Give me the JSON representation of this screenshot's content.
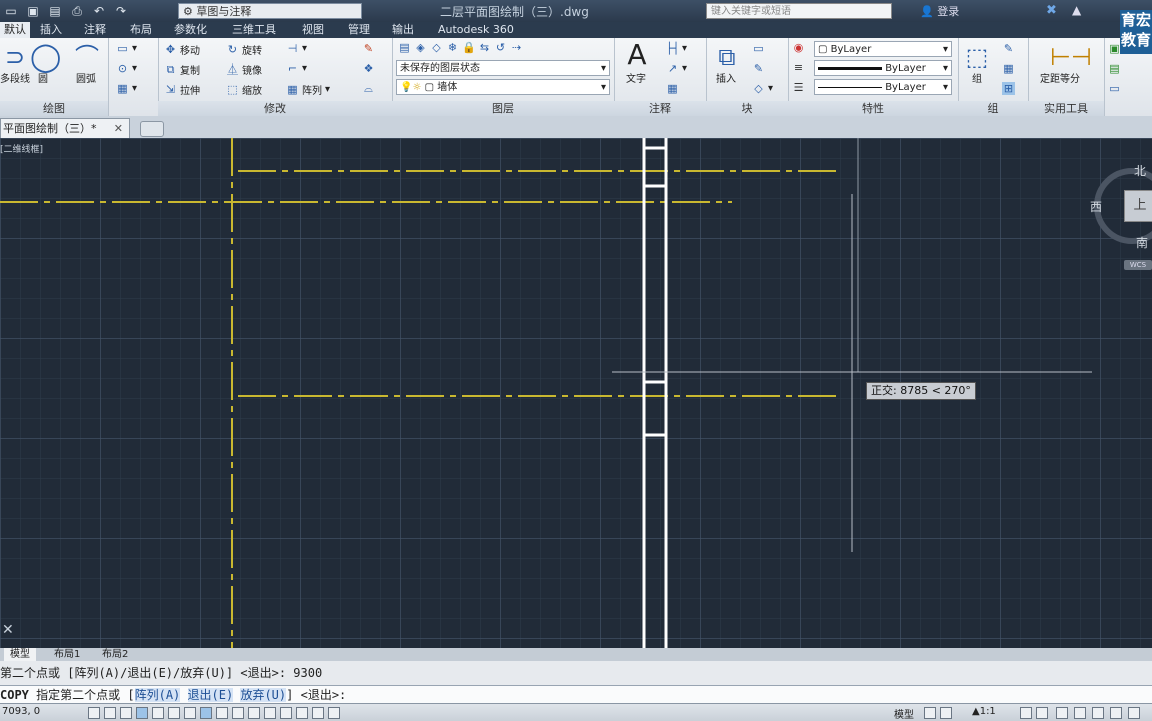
{
  "window": {
    "title": "二层平面图绘制（三）.dwg",
    "workspace": "草图与注释",
    "search_placeholder": "键入关键字或短语",
    "login": "登录"
  },
  "ribbon_tabs": [
    "默认",
    "插入",
    "注释",
    "布局",
    "参数化",
    "三维工具",
    "视图",
    "管理",
    "输出",
    "Autodesk 360"
  ],
  "panels": {
    "draw": {
      "label": "绘图",
      "tools": [
        "多段线",
        "圆",
        "圆弧"
      ]
    },
    "modify": {
      "label": "修改",
      "tools": [
        "移动",
        "旋转",
        "复制",
        "镜像",
        "拉伸",
        "缩放",
        "阵列"
      ]
    },
    "layers": {
      "label": "图层",
      "state": "未保存的图层状态",
      "current_layer": "墙体"
    },
    "annotation": {
      "label": "注释",
      "text_tool": "文字"
    },
    "block": {
      "label": "块",
      "insert_tool": "插入"
    },
    "properties": {
      "label": "特性",
      "color": "ByLayer",
      "linetype": "ByLayer",
      "lineweight": "ByLayer"
    },
    "groups": {
      "label": "组",
      "group_tool": "组"
    },
    "utilities": {
      "label": "实用工具",
      "measure_tool": "定距等分"
    }
  },
  "document_tab": "平面图绘制（三）*",
  "viewport_label": "[二维线框]",
  "viewcube": {
    "north": "北",
    "west": "西",
    "south": "南",
    "top": "上",
    "wcs": "WCS"
  },
  "ortho_tooltip": "正交: 8785 < 270°",
  "layout_tabs": [
    "模型",
    "布局1",
    "布局2"
  ],
  "command_history": "第二个点或 [阵列(A)/退出(E)/放弃(U)] <退出>: 9300",
  "command_line": {
    "command": "COPY",
    "prompt": "指定第二个点或",
    "options": [
      "阵列(A)",
      "退出(E)",
      "放弃(U)"
    ],
    "default": "<退出>:"
  },
  "status": {
    "coordinates": "7093, 0",
    "space": "模型",
    "scale": "1:1"
  },
  "logo_text": "育宏教育",
  "colors": {
    "axis_line": "#c9b830",
    "wall": "#ffffff",
    "background": "#212b38"
  }
}
